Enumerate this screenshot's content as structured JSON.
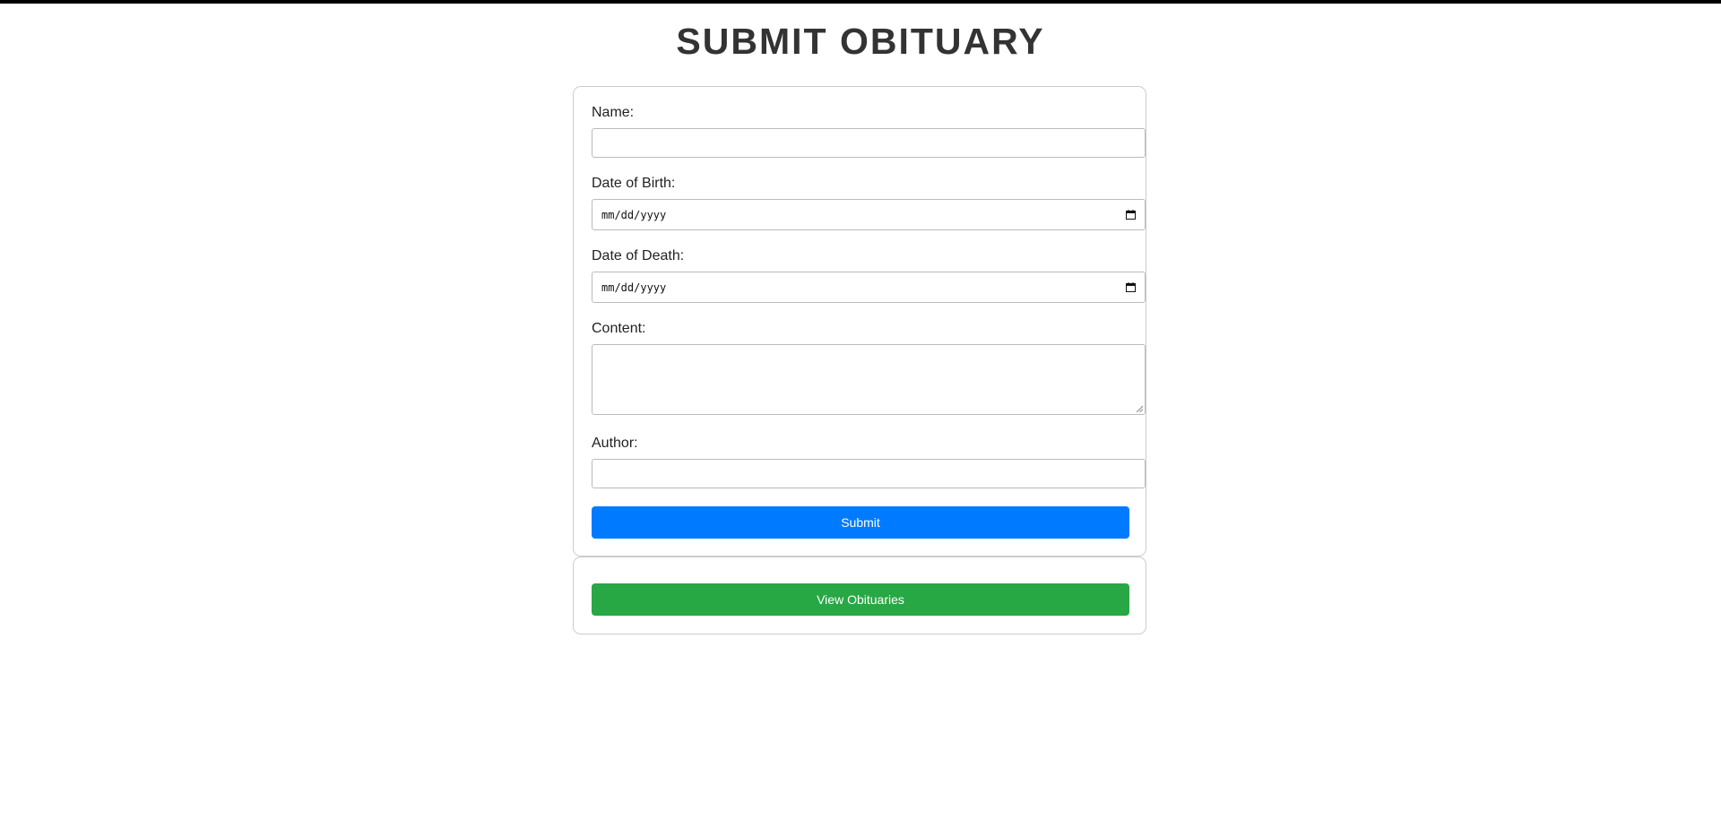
{
  "page": {
    "title": "SUBMIT OBITUARY"
  },
  "form": {
    "name": {
      "label": "Name:",
      "value": ""
    },
    "date_of_birth": {
      "label": "Date of Birth:",
      "placeholder": "mm/dd/yyyy"
    },
    "date_of_death": {
      "label": "Date of Death:",
      "placeholder": "mm/dd/yyyy"
    },
    "content": {
      "label": "Content:",
      "value": ""
    },
    "author": {
      "label": "Author:",
      "value": ""
    },
    "submit_label": "Submit"
  },
  "view": {
    "button_label": "View Obituaries"
  },
  "colors": {
    "submit": "#007bff",
    "view": "#28a745",
    "title": "#333333"
  },
  "icons": {
    "date_picker": "calendar-icon",
    "textarea_resize": "resize-grip-icon"
  }
}
